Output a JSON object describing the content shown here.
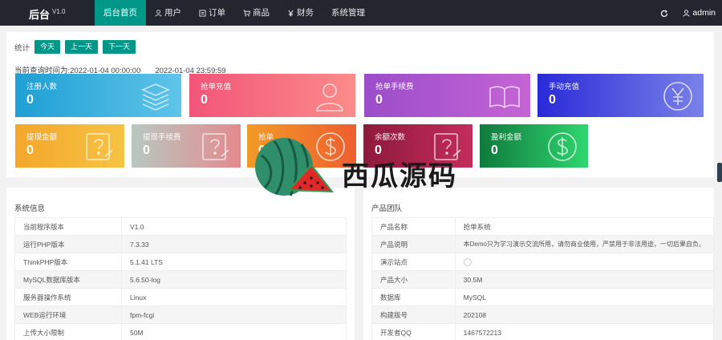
{
  "header": {
    "brand": "后台",
    "version": "V1.0",
    "nav": [
      {
        "label": "后台首页",
        "icon": "",
        "active": true
      },
      {
        "label": "用户",
        "icon": "user-icon",
        "active": false
      },
      {
        "label": "订单",
        "icon": "order-icon",
        "active": false
      },
      {
        "label": "商品",
        "icon": "cart-icon",
        "active": false
      },
      {
        "label": "财务",
        "icon": "yen-icon",
        "active": false
      },
      {
        "label": "系统管理",
        "icon": "",
        "active": false
      }
    ],
    "user": "admin"
  },
  "stats": {
    "label": "统计",
    "buttons": [
      "今天",
      "上一天",
      "下一天"
    ],
    "time_prefix": "当前查询时间为:",
    "time_start": "2022-01-04 00:00:00",
    "time_end": "2022-01-04 23:59:59"
  },
  "cards": [
    {
      "label": "注册人数",
      "value": "0",
      "icon": "stack-icon"
    },
    {
      "label": "抢单充值",
      "value": "0",
      "icon": "user-icon"
    },
    {
      "label": "抢单手续费",
      "value": "0",
      "icon": "book-icon"
    },
    {
      "label": "手动充值",
      "value": "0",
      "icon": "yen-icon"
    },
    {
      "label": "提现金额",
      "value": "0",
      "icon": "question-note-icon"
    },
    {
      "label": "提现手续费",
      "value": "0",
      "icon": "question-note-icon"
    },
    {
      "label": "抢单",
      "value": "0",
      "icon": "dollar-icon"
    },
    {
      "label": "余额次数",
      "value": "0",
      "icon": "question-note-icon"
    },
    {
      "label": "盈利金额",
      "value": "0",
      "icon": "dollar-icon"
    }
  ],
  "system": {
    "title": "系统信息",
    "rows": [
      {
        "k": "当前程序版本",
        "v": "V1.0"
      },
      {
        "k": "运行PHP版本",
        "v": "7.3.33"
      },
      {
        "k": "ThinkPHP版本",
        "v": "5.1.41 LTS"
      },
      {
        "k": "MySQL数据库版本",
        "v": "5.6.50-log"
      },
      {
        "k": "服务器操作系统",
        "v": "Linux"
      },
      {
        "k": "WEB运行环境",
        "v": "fpm-fcgi"
      },
      {
        "k": "上传大小限制",
        "v": "50M"
      }
    ]
  },
  "product": {
    "title": "产品团队",
    "rows": [
      {
        "k": "产品名称",
        "v": "抢单系统"
      },
      {
        "k": "产品说明",
        "v": "本Demo只为学习演示交流所用，请勿商业使用，严禁用于非法用途，一切后果自负。"
      },
      {
        "k": "演示站点",
        "v": ""
      },
      {
        "k": "产品大小",
        "v": "30.5M"
      },
      {
        "k": "数据库",
        "v": "MySQL"
      },
      {
        "k": "构建版号",
        "v": "202108"
      },
      {
        "k": "开发者QQ",
        "v": "1467572213"
      }
    ]
  },
  "watermark": {
    "text": "西瓜源码"
  },
  "colors": {
    "topbar": "#23262e",
    "accent": "#009688"
  }
}
